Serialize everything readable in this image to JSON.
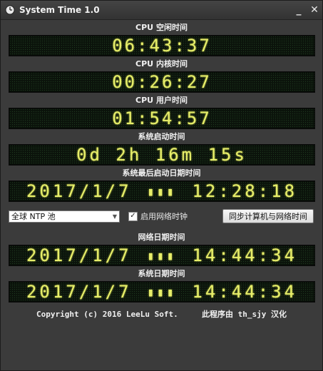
{
  "window": {
    "title": "System Time 1.0",
    "minimize": "_",
    "close": "✕"
  },
  "cpu_idle": {
    "label": "CPU 空闲时间",
    "value": "06:43:37"
  },
  "cpu_kernel": {
    "label": "CPU 内核时间",
    "value": "00:26:27"
  },
  "cpu_user": {
    "label": "CPU 用户时间",
    "value": "01:54:57"
  },
  "uptime": {
    "label": "系统启动时间",
    "value": "0d 2h 16m 15s"
  },
  "last_boot": {
    "label": "系统最后启动日期时间",
    "date": "2017/1/7",
    "weekday": "▮▮▮",
    "time": "12:28:18"
  },
  "ntp": {
    "pool_selected": "全球 NTP 池",
    "enable_label": "启用网络时钟",
    "enable_checked": "✓",
    "sync_button": "同步计算机与网络时间"
  },
  "net_time": {
    "label": "网络日期时间",
    "date": "2017/1/7",
    "weekday": "▮▮▮",
    "time": "14:44:34"
  },
  "sys_time": {
    "label": "系统日期时间",
    "date": "2017/1/7",
    "weekday": "▮▮▮",
    "time": "14:44:34"
  },
  "footer": {
    "copyright": "Copyright (c) 2016 LeeLu Soft.",
    "localized": "此程序由 th_sjy 汉化"
  }
}
